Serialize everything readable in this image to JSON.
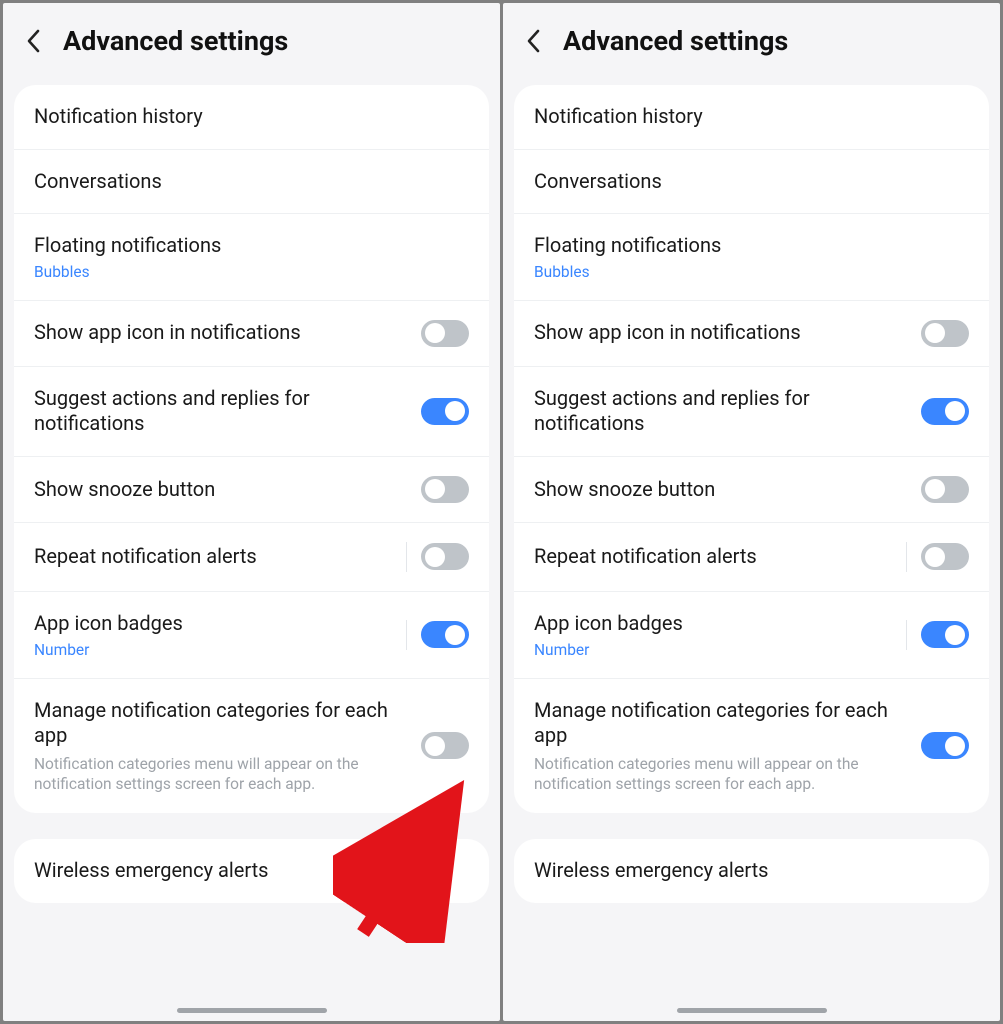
{
  "header": {
    "title": "Advanced settings"
  },
  "rows": {
    "history": {
      "label": "Notification history"
    },
    "conversations": {
      "label": "Conversations"
    },
    "floating": {
      "label": "Floating notifications",
      "sub": "Bubbles"
    },
    "appicon": {
      "label": "Show app icon in notifications"
    },
    "suggest": {
      "label": "Suggest actions and replies for notifications"
    },
    "snooze": {
      "label": "Show snooze button"
    },
    "repeat": {
      "label": "Repeat notification alerts"
    },
    "badges": {
      "label": "App icon badges",
      "sub": "Number"
    },
    "categories": {
      "label": "Manage notification categories for each app",
      "desc": "Notification categories menu will appear on the notification settings screen for each app."
    },
    "emergency": {
      "label": "Wireless emergency alerts"
    }
  },
  "panels": [
    {
      "categories_on": false,
      "show_arrow": true
    },
    {
      "categories_on": true,
      "show_arrow": false
    }
  ],
  "toggles": {
    "appicon": false,
    "suggest": true,
    "snooze": false,
    "repeat": false,
    "badges": true
  }
}
